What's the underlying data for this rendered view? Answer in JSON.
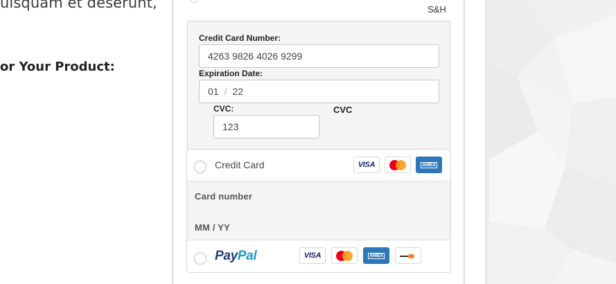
{
  "left": {
    "paragraph_fragment": "uisquam et deserunt,",
    "heading_fragment": "or Your Product:"
  },
  "shipping": {
    "label": "S&H"
  },
  "credit_card_form": {
    "number_label": "Credit Card Number:",
    "number_value": "4263 9826 4026 9299",
    "expiration_label": "Expiration Date:",
    "exp_month": "01",
    "exp_separator": "/",
    "exp_year": "22",
    "cvc_label": "CVC:",
    "cvc_value": "123",
    "cvc_side_label": "CVC"
  },
  "payment_methods": {
    "credit_card": {
      "label": "Credit Card",
      "card_number_placeholder": "Card number",
      "expiry_placeholder": "MM / YY",
      "brands": [
        "VISA",
        "mastercard",
        "AMEX"
      ]
    },
    "paypal": {
      "label_pay": "Pay",
      "label_pal": "Pal",
      "brands": [
        "VISA",
        "mastercard",
        "AMEX",
        "discover"
      ]
    }
  },
  "icons": {
    "visa": "visa-icon",
    "mastercard": "mastercard-icon",
    "amex": "amex-icon",
    "discover": "discover-icon",
    "amex_text": "AMEX",
    "visa_text": "VISA"
  },
  "colors": {
    "paypal_dark": "#253b80",
    "paypal_light": "#179bd7",
    "amex_blue": "#2e77bb",
    "visa_navy": "#1a1f71",
    "mc_red": "#eb001b",
    "mc_orange": "#f79e1b"
  }
}
